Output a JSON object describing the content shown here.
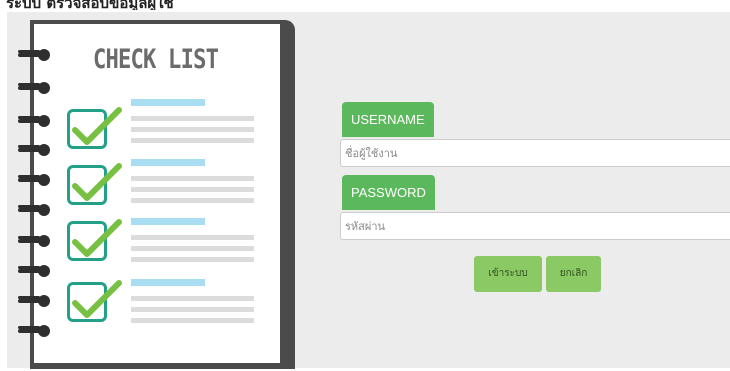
{
  "top_strip": {
    "text": "ระบบ  ตรวจสอบข้อมูลผู้ใช้"
  },
  "illustration": {
    "title": "CHECK LIST",
    "tab_colors": [
      "#e85aa8",
      "#f2c21b"
    ],
    "checkbox_color": "#24a089",
    "checkmark_color": "#77c043"
  },
  "login_form": {
    "username_label": "USERNAME",
    "username_placeholder": "ชื่อผู้ใช้งาน",
    "username_value": "",
    "password_label": "PASSWORD",
    "password_placeholder": "รหัสผ่าน",
    "password_value": "",
    "login_button": "เข้าระบบ",
    "cancel_button": "ยกเลิก"
  },
  "colors": {
    "label_green": "#5cb85c",
    "button_green": "#8bc965",
    "background_gray": "#ececec"
  }
}
